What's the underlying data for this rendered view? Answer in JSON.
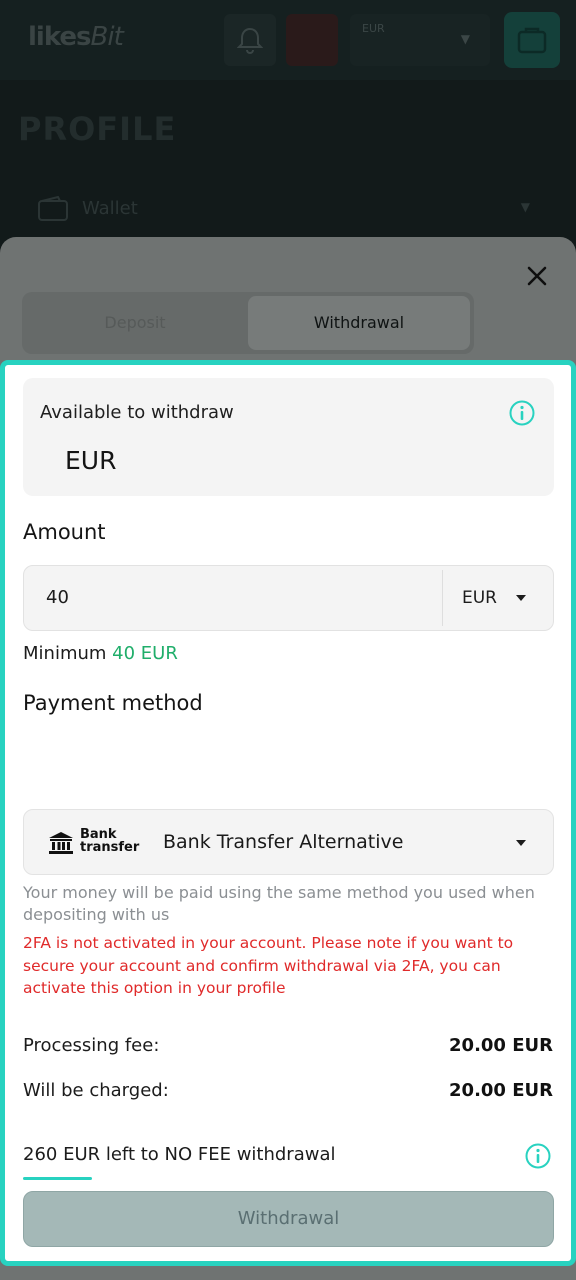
{
  "background_app": {
    "logo_text": "likes",
    "logo_script": "Bit",
    "currency_selector": "EUR",
    "page_title": "PROFILE",
    "wallet_label": "Wallet"
  },
  "modal": {
    "tabs": [
      {
        "label": "Deposit",
        "active": false
      },
      {
        "label": "Withdrawal",
        "active": true
      }
    ]
  },
  "form": {
    "available": {
      "label": "Available to withdraw",
      "currency": "EUR"
    },
    "amount": {
      "label": "Amount",
      "value": "40",
      "currency": "EUR"
    },
    "minimum": {
      "label": "Minimum",
      "value": "40 EUR"
    },
    "payment_method": {
      "label": "Payment method",
      "logo_line1": "Bank",
      "logo_line2": "transfer",
      "selected": "Bank Transfer Alternative"
    },
    "hint": "Your money will be paid using the same method you used when depositing with us",
    "warning": "2FA is not activated in your account. Please note if you want to secure your account and confirm withdrawal via 2FA, you can activate this option in your profile",
    "fees": {
      "processing_label": "Processing fee:",
      "processing_value": "20.00 EUR",
      "charged_label": "Will be charged:",
      "charged_value": "20.00 EUR"
    },
    "no_fee": {
      "text": "260 EUR left to NO FEE withdrawal",
      "progress_fraction": 0.13
    },
    "submit_label": "Withdrawal"
  },
  "colors": {
    "accent": "#28d2c0",
    "minimum_value": "#1fae6a",
    "warning": "#e02a2a",
    "disabled_button": "#a4b8b7"
  }
}
